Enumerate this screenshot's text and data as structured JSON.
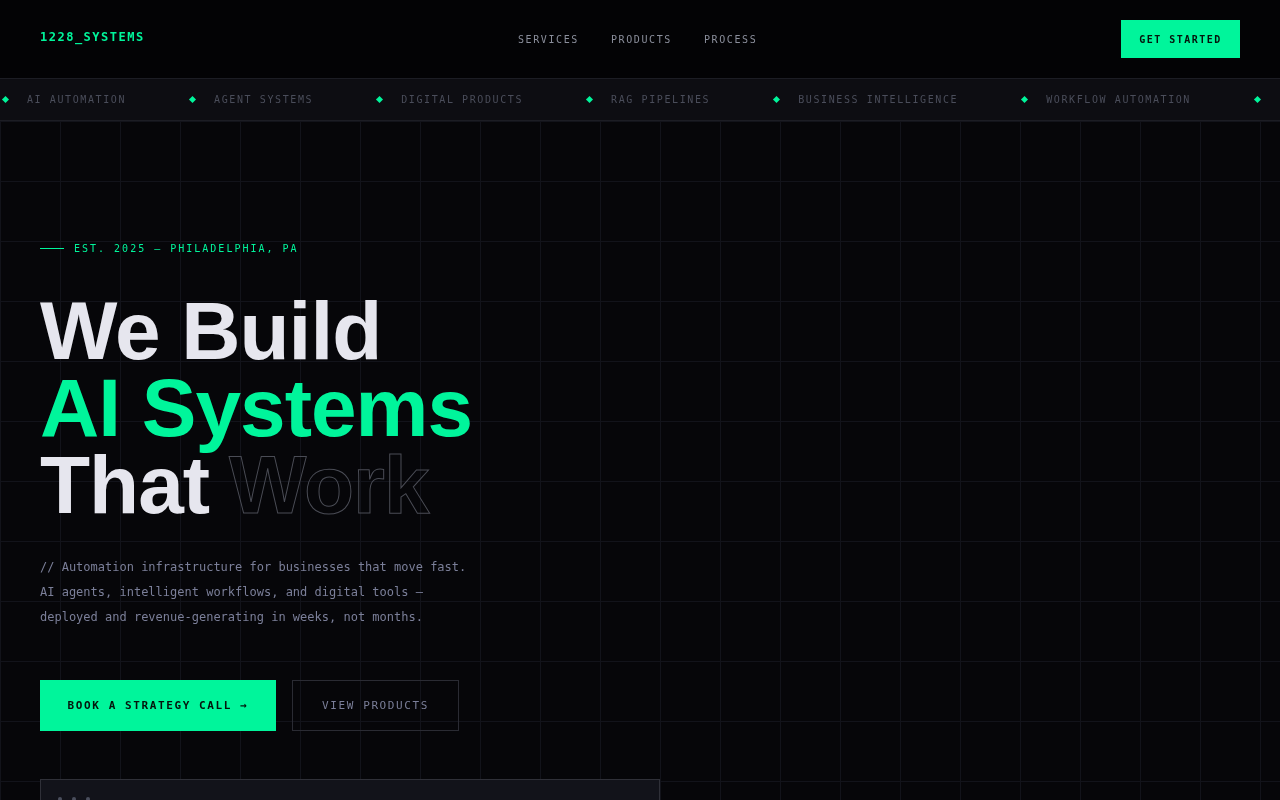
{
  "nav": {
    "logo": "1228_SYSTEMS",
    "links": [
      "SERVICES",
      "PRODUCTS",
      "PROCESS"
    ],
    "cta": "GET STARTED"
  },
  "ticker": [
    "AI AUTOMATION",
    "AGENT SYSTEMS",
    "DIGITAL PRODUCTS",
    "RAG PIPELINES",
    "BUSINESS INTELLIGENCE",
    "WORKFLOW AUTOMATION"
  ],
  "hero": {
    "eyebrow": "EST. 2025 — PHILADELPHIA, PA",
    "headline": [
      [
        {
          "text": "We Build",
          "kind": "solid"
        }
      ],
      [
        {
          "text": "AI Systems",
          "kind": "accent"
        }
      ],
      [
        {
          "text": "That",
          "kind": "solid"
        },
        {
          "text": "Work",
          "kind": "outline"
        }
      ]
    ],
    "description": [
      "// Automation infrastructure for businesses that move fast.",
      "AI agents, intelligent workflows, and digital tools —",
      "deployed and revenue-generating in weeks, not months."
    ],
    "buttons": [
      {
        "label": "BOOK A STRATEGY CALL →",
        "kind": "primary"
      },
      {
        "label": "VIEW PRODUCTS",
        "kind": "secondary"
      }
    ]
  }
}
